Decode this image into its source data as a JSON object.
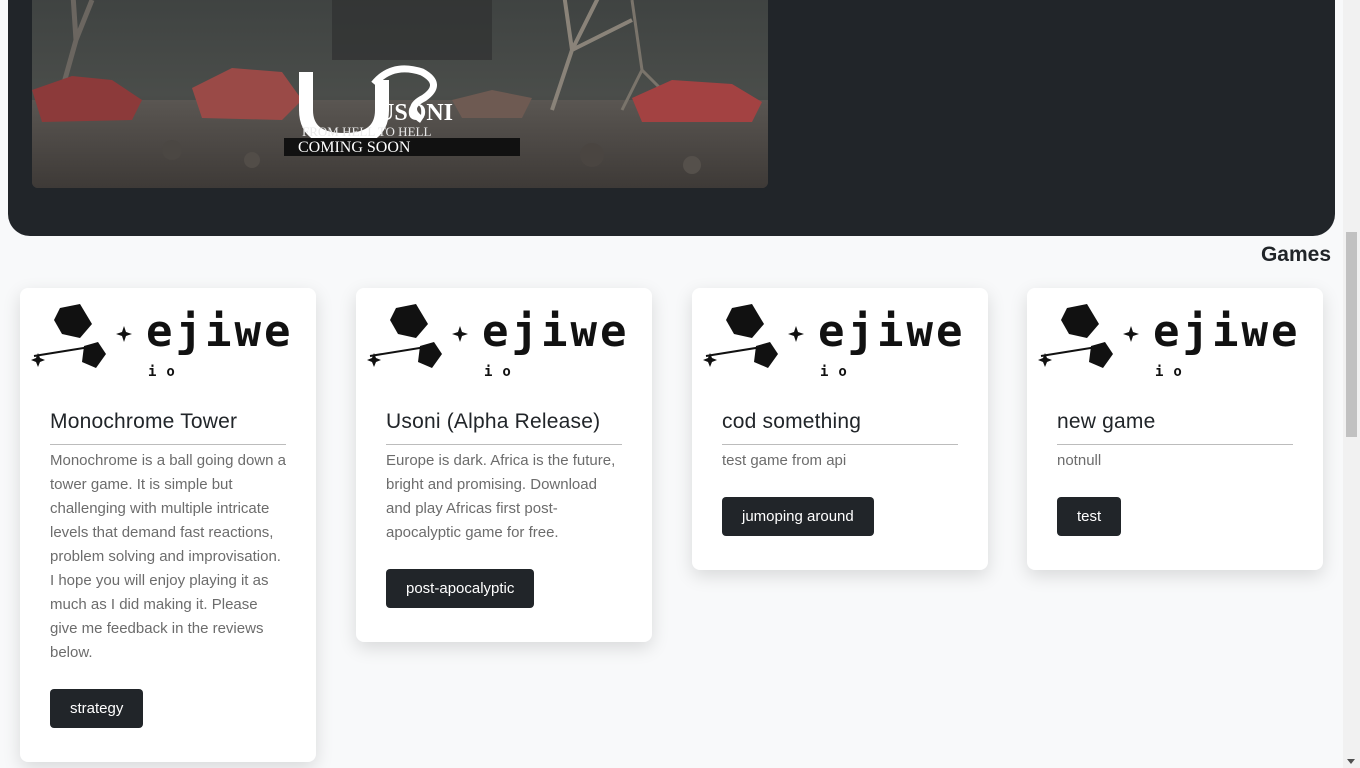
{
  "hero": {
    "banner_logo": "USONI",
    "banner_tagline": "FROM HELL TO HELL",
    "banner_status": "COMING SOON"
  },
  "games_section": {
    "title": "Games"
  },
  "card_logo_text": "EJIWE IO",
  "cards": [
    {
      "title": "Monochrome Tower",
      "description": "Monochrome is a ball going down a tower game. It is simple but challenging with multiple intricate levels that demand fast reactions, problem solving and improvisation. I hope you will enjoy playing it as much as I did making it. Please give me feedback in the reviews below.",
      "tag": "strategy"
    },
    {
      "title": "Usoni (Alpha Release)",
      "description": "Europe is dark. Africa is the future, bright and promising. Download and play Africas first post-apocalyptic game for free.",
      "tag": "post-apocalyptic"
    },
    {
      "title": "cod something",
      "description": "test game from api",
      "tag": "jumoping around"
    },
    {
      "title": "new game",
      "description": "notnull",
      "tag": "test"
    }
  ],
  "colors": {
    "dark": "#212529",
    "background": "#f8f9fa",
    "card": "#ffffff"
  }
}
